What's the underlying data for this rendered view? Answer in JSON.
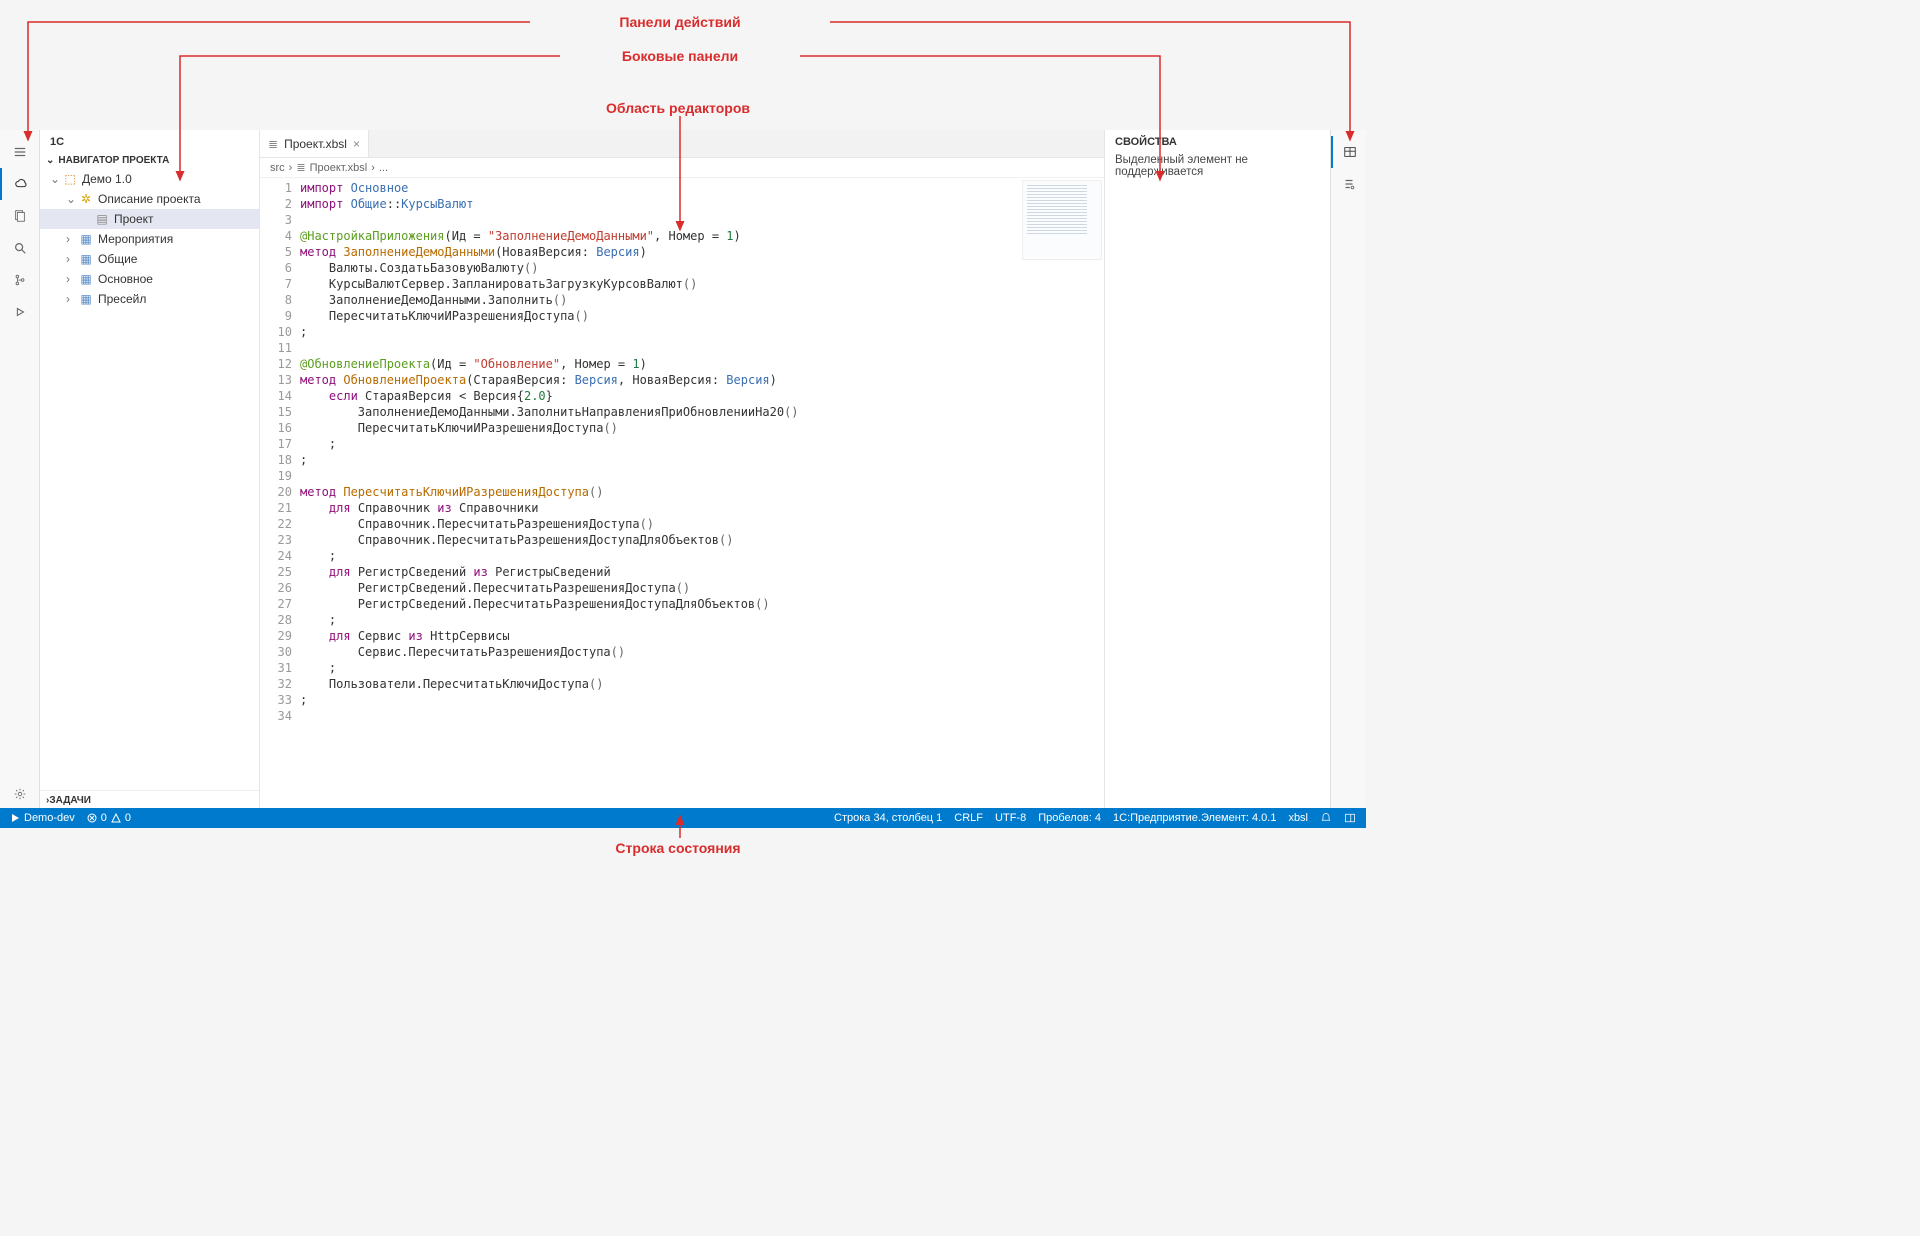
{
  "annotations": {
    "action_panels": "Панели действий",
    "side_panels": "Боковые панели",
    "editor_area": "Область редакторов",
    "status_bar": "Строка состояния"
  },
  "sidebar": {
    "title": "1C",
    "navigator": "НАВИГАТОР ПРОЕКТА",
    "project_root": "Демо 1.0",
    "node_description": "Описание проекта",
    "node_project": "Проект",
    "node_events": "Мероприятия",
    "node_common": "Общие",
    "node_main": "Основное",
    "node_presale": "Пресейл",
    "tasks": "ЗАДАЧИ"
  },
  "editor": {
    "tab_name": "Проект.xbsl",
    "breadcrumb_src": "src",
    "breadcrumb_file": "Проект.xbsl",
    "breadcrumb_more": "..."
  },
  "code_lines": [
    {
      "n": 1,
      "html": "<span class='kw'>импорт</span> <span class='kw2'>Основное</span>"
    },
    {
      "n": 2,
      "html": "<span class='kw'>импорт</span> <span class='kw2'>Общие</span>::<span class='kw2'>КурсыВалют</span>"
    },
    {
      "n": 3,
      "html": ""
    },
    {
      "n": 4,
      "html": "<span class='ann'>@НастройкаПриложения</span>(Ид = <span class='str'>\"ЗаполнениеДемоДанными\"</span>, Номер = <span class='num'>1</span>)"
    },
    {
      "n": 5,
      "html": "<span class='kw'>метод</span> <span class='fn'>ЗаполнениеДемоДанными</span>(НоваяВерсия: <span class='kw2'>Версия</span>)"
    },
    {
      "n": 6,
      "html": "    Валюты.СоздатьБазовуюВалюту<span class='par'>()</span>"
    },
    {
      "n": 7,
      "html": "    КурсыВалютСервер.ЗапланироватьЗагрузкуКурсовВалют<span class='par'>()</span>"
    },
    {
      "n": 8,
      "html": "    ЗаполнениеДемоДанными.Заполнить<span class='par'>()</span>"
    },
    {
      "n": 9,
      "html": "    ПересчитатьКлючиИРазрешенияДоступа<span class='par'>()</span>"
    },
    {
      "n": 10,
      "html": ";"
    },
    {
      "n": 11,
      "html": ""
    },
    {
      "n": 12,
      "html": "<span class='ann'>@ОбновлениеПроекта</span>(Ид = <span class='str'>\"Обновление\"</span>, Номер = <span class='num'>1</span>)"
    },
    {
      "n": 13,
      "html": "<span class='kw'>метод</span> <span class='fn'>ОбновлениеПроекта</span>(СтараяВерсия: <span class='kw2'>Версия</span>, НоваяВерсия: <span class='kw2'>Версия</span>)"
    },
    {
      "n": 14,
      "html": "    <span class='kw'>если</span> СтараяВерсия &lt; Версия{<span class='num'>2.0</span>}"
    },
    {
      "n": 15,
      "html": "        ЗаполнениеДемоДанными.ЗаполнитьНаправленияПриОбновленииНа20<span class='par'>()</span>"
    },
    {
      "n": 16,
      "html": "        ПересчитатьКлючиИРазрешенияДоступа<span class='par'>()</span>"
    },
    {
      "n": 17,
      "html": "    ;"
    },
    {
      "n": 18,
      "html": ";"
    },
    {
      "n": 19,
      "html": ""
    },
    {
      "n": 20,
      "html": "<span class='kw'>метод</span> <span class='fn'>ПересчитатьКлючиИРазрешенияДоступа</span><span class='par'>()</span>"
    },
    {
      "n": 21,
      "html": "    <span class='kw'>для</span> Справочник <span class='kw'>из</span> Справочники"
    },
    {
      "n": 22,
      "html": "        Справочник.ПересчитатьРазрешенияДоступа<span class='par'>()</span>"
    },
    {
      "n": 23,
      "html": "        Справочник.ПересчитатьРазрешенияДоступаДляОбъектов<span class='par'>()</span>"
    },
    {
      "n": 24,
      "html": "    ;"
    },
    {
      "n": 25,
      "html": "    <span class='kw'>для</span> РегистрСведений <span class='kw'>из</span> РегистрыСведений"
    },
    {
      "n": 26,
      "html": "        РегистрСведений.ПересчитатьРазрешенияДоступа<span class='par'>()</span>"
    },
    {
      "n": 27,
      "html": "        РегистрСведений.ПересчитатьРазрешенияДоступаДляОбъектов<span class='par'>()</span>"
    },
    {
      "n": 28,
      "html": "    ;"
    },
    {
      "n": 29,
      "html": "    <span class='kw'>для</span> Сервис <span class='kw'>из</span> HttpСервисы"
    },
    {
      "n": 30,
      "html": "        Сервис.ПересчитатьРазрешенияДоступа<span class='par'>()</span>"
    },
    {
      "n": 31,
      "html": "    ;"
    },
    {
      "n": 32,
      "html": "    Пользователи.ПересчитатьКлючиДоступа<span class='par'>()</span>"
    },
    {
      "n": 33,
      "html": ";"
    },
    {
      "n": 34,
      "html": ""
    }
  ],
  "right_panel": {
    "title": "СВОЙСТВА",
    "message": "Выделенный элемент не поддерживается"
  },
  "statusbar": {
    "demo": "Demo-dev",
    "errors": "0",
    "warnings": "0",
    "cursor": "Строка 34, столбец 1",
    "eol": "CRLF",
    "encoding": "UTF-8",
    "spaces": "Пробелов: 4",
    "platform": "1С:Предприятие.Элемент: 4.0.1",
    "lang": "xbsl"
  }
}
